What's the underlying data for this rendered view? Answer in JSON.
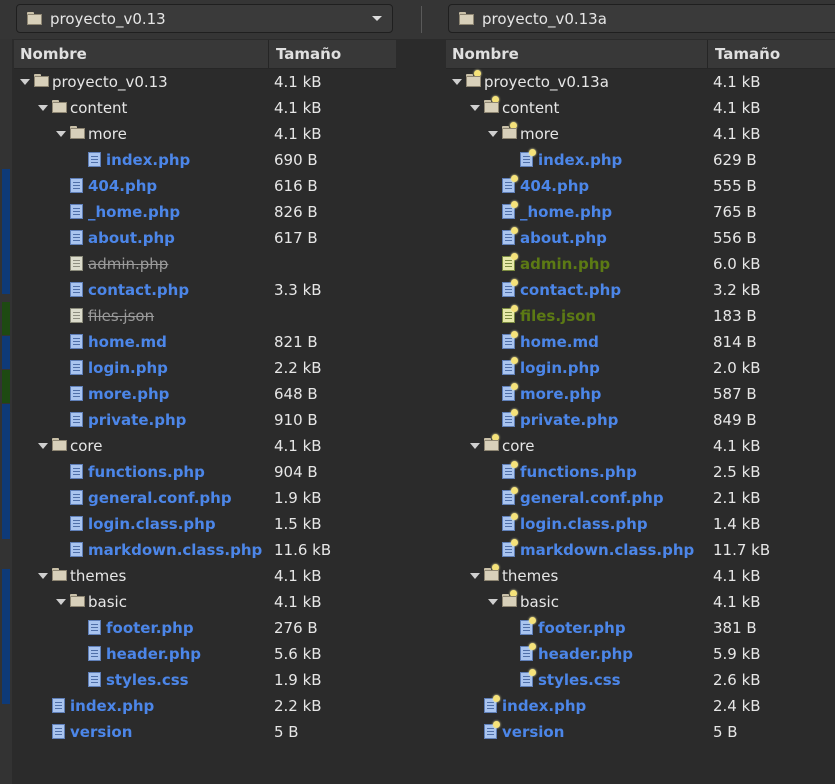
{
  "left": {
    "location": "proyecto_v0.13",
    "col_name": "Nombre",
    "col_size": "Tamaño",
    "rows": [
      {
        "name": "proyecto_v0.13",
        "size": "4.1 kB",
        "type": "folder",
        "expanded": true,
        "style": "plain",
        "depth": 0
      },
      {
        "name": "content",
        "size": "4.1 kB",
        "type": "folder",
        "expanded": true,
        "style": "plain",
        "depth": 1
      },
      {
        "name": "more",
        "size": "4.1 kB",
        "type": "folder",
        "expanded": true,
        "style": "plain",
        "depth": 2
      },
      {
        "name": "index.php",
        "size": "690 B",
        "type": "file",
        "style": "blue",
        "depth": 3
      },
      {
        "name": "404.php",
        "size": "616 B",
        "type": "file",
        "style": "blue",
        "depth": 2
      },
      {
        "name": "_home.php",
        "size": "826 B",
        "type": "file",
        "style": "blue",
        "depth": 2
      },
      {
        "name": "about.php",
        "size": "617 B",
        "type": "file",
        "style": "blue",
        "depth": 2
      },
      {
        "name": "admin.php",
        "size": "",
        "type": "file",
        "style": "gray",
        "depth": 2
      },
      {
        "name": "contact.php",
        "size": "3.3 kB",
        "type": "file",
        "style": "blue",
        "depth": 2
      },
      {
        "name": "files.json",
        "size": "",
        "type": "file",
        "style": "gray",
        "depth": 2
      },
      {
        "name": "home.md",
        "size": "821 B",
        "type": "file",
        "style": "blue",
        "depth": 2
      },
      {
        "name": "login.php",
        "size": "2.2 kB",
        "type": "file",
        "style": "blue",
        "depth": 2
      },
      {
        "name": "more.php",
        "size": "648 B",
        "type": "file",
        "style": "blue",
        "depth": 2
      },
      {
        "name": "private.php",
        "size": "910 B",
        "type": "file",
        "style": "blue",
        "depth": 2
      },
      {
        "name": "core",
        "size": "4.1 kB",
        "type": "folder",
        "expanded": true,
        "style": "plain",
        "depth": 1
      },
      {
        "name": "functions.php",
        "size": "904 B",
        "type": "file",
        "style": "blue",
        "depth": 2
      },
      {
        "name": "general.conf.php",
        "size": "1.9 kB",
        "type": "file",
        "style": "blue",
        "depth": 2
      },
      {
        "name": "login.class.php",
        "size": "1.5 kB",
        "type": "file",
        "style": "blue",
        "depth": 2
      },
      {
        "name": "markdown.class.php",
        "size": "11.6 kB",
        "type": "file",
        "style": "blue",
        "depth": 2
      },
      {
        "name": "themes",
        "size": "4.1 kB",
        "type": "folder",
        "expanded": true,
        "style": "plain",
        "depth": 1
      },
      {
        "name": "basic",
        "size": "4.1 kB",
        "type": "folder",
        "expanded": true,
        "style": "plain",
        "depth": 2
      },
      {
        "name": "footer.php",
        "size": "276 B",
        "type": "file",
        "style": "blue",
        "depth": 3
      },
      {
        "name": "header.php",
        "size": "5.6 kB",
        "type": "file",
        "style": "blue",
        "depth": 3
      },
      {
        "name": "styles.css",
        "size": "1.9 kB",
        "type": "file",
        "style": "blue",
        "depth": 3
      },
      {
        "name": "index.php",
        "size": "2.2 kB",
        "type": "file",
        "style": "blue",
        "depth": 1
      },
      {
        "name": "version",
        "size": "5 B",
        "type": "file",
        "style": "blue",
        "depth": 1
      }
    ]
  },
  "right": {
    "location": "proyecto_v0.13a",
    "col_name": "Nombre",
    "col_size": "Tamaño",
    "rows": [
      {
        "name": "proyecto_v0.13a",
        "size": "4.1 kB",
        "type": "folder",
        "expanded": true,
        "style": "plain",
        "depth": 0
      },
      {
        "name": "content",
        "size": "4.1 kB",
        "type": "folder",
        "expanded": true,
        "style": "plain",
        "depth": 1
      },
      {
        "name": "more",
        "size": "4.1 kB",
        "type": "folder",
        "expanded": true,
        "style": "plain",
        "depth": 2
      },
      {
        "name": "index.php",
        "size": "629 B",
        "type": "file",
        "style": "blue",
        "depth": 3
      },
      {
        "name": "404.php",
        "size": "555 B",
        "type": "file",
        "style": "blue",
        "depth": 2
      },
      {
        "name": "_home.php",
        "size": "765 B",
        "type": "file",
        "style": "blue",
        "depth": 2
      },
      {
        "name": "about.php",
        "size": "556 B",
        "type": "file",
        "style": "blue",
        "depth": 2
      },
      {
        "name": "admin.php",
        "size": "6.0 kB",
        "type": "file",
        "style": "green",
        "depth": 2
      },
      {
        "name": "contact.php",
        "size": "3.2 kB",
        "type": "file",
        "style": "blue",
        "depth": 2
      },
      {
        "name": "files.json",
        "size": "183 B",
        "type": "file",
        "style": "green",
        "depth": 2
      },
      {
        "name": "home.md",
        "size": "814 B",
        "type": "file",
        "style": "blue",
        "depth": 2
      },
      {
        "name": "login.php",
        "size": "2.0 kB",
        "type": "file",
        "style": "blue",
        "depth": 2
      },
      {
        "name": "more.php",
        "size": "587 B",
        "type": "file",
        "style": "blue",
        "depth": 2
      },
      {
        "name": "private.php",
        "size": "849 B",
        "type": "file",
        "style": "blue",
        "depth": 2
      },
      {
        "name": "core",
        "size": "4.1 kB",
        "type": "folder",
        "expanded": true,
        "style": "plain",
        "depth": 1
      },
      {
        "name": "functions.php",
        "size": "2.5 kB",
        "type": "file",
        "style": "blue",
        "depth": 2
      },
      {
        "name": "general.conf.php",
        "size": "2.1 kB",
        "type": "file",
        "style": "blue",
        "depth": 2
      },
      {
        "name": "login.class.php",
        "size": "1.4 kB",
        "type": "file",
        "style": "blue",
        "depth": 2
      },
      {
        "name": "markdown.class.php",
        "size": "11.7 kB",
        "type": "file",
        "style": "blue",
        "depth": 2
      },
      {
        "name": "themes",
        "size": "4.1 kB",
        "type": "folder",
        "expanded": true,
        "style": "plain",
        "depth": 1
      },
      {
        "name": "basic",
        "size": "4.1 kB",
        "type": "folder",
        "expanded": true,
        "style": "plain",
        "depth": 2
      },
      {
        "name": "footer.php",
        "size": "381 B",
        "type": "file",
        "style": "blue",
        "depth": 3
      },
      {
        "name": "header.php",
        "size": "5.9 kB",
        "type": "file",
        "style": "blue",
        "depth": 3
      },
      {
        "name": "styles.css",
        "size": "2.6 kB",
        "type": "file",
        "style": "blue",
        "depth": 3
      },
      {
        "name": "index.php",
        "size": "2.4 kB",
        "type": "file",
        "style": "blue",
        "depth": 1
      },
      {
        "name": "version",
        "size": "5 B",
        "type": "file",
        "style": "blue",
        "depth": 1
      }
    ]
  },
  "colors": {
    "modified": "#4c86e8",
    "missing": "#9a9a9a",
    "new": "#5c7a14",
    "diff_blue": "#0e3a78",
    "diff_green": "#1e4a12"
  }
}
